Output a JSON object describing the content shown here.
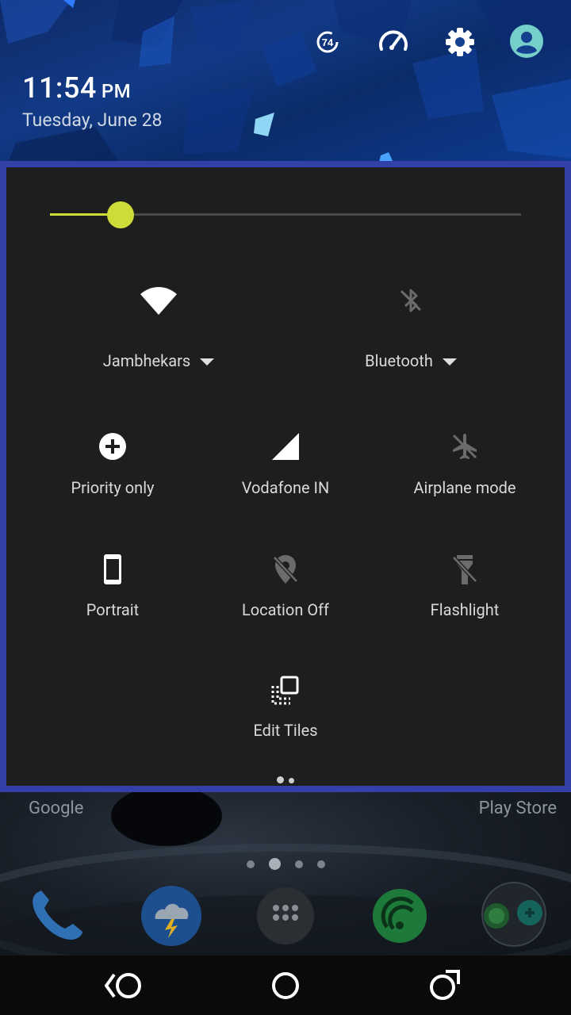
{
  "status": {
    "time": "11:54",
    "ampm": "PM",
    "date": "Tuesday, June 28",
    "battery_badge": "74",
    "header_icons": [
      "battery-saver-icon",
      "speed-icon",
      "gear-icon",
      "account-icon"
    ]
  },
  "brightness": {
    "level": 0.15
  },
  "tiles": {
    "wifi": {
      "label": "Jambhekars",
      "icon": "wifi-icon",
      "state": "on"
    },
    "bluetooth": {
      "label": "Bluetooth",
      "icon": "bluetooth-off-icon",
      "state": "off"
    },
    "priority": {
      "label": "Priority only",
      "icon": "priority-plus-icon"
    },
    "cellular": {
      "label": "Vodafone IN",
      "icon": "signal-icon"
    },
    "airplane": {
      "label": "Airplane mode",
      "icon": "airplane-off-icon"
    },
    "rotation": {
      "label": "Portrait",
      "icon": "phone-portrait-icon"
    },
    "location": {
      "label": "Location Off",
      "icon": "location-off-icon"
    },
    "flashlight": {
      "label": "Flashlight",
      "icon": "flashlight-off-icon"
    },
    "edit": {
      "label": "Edit Tiles",
      "icon": "edit-tiles-icon"
    }
  },
  "qs_pages": {
    "count": 2,
    "active": 0
  },
  "launcher": {
    "left_label": "Google",
    "right_label": "Play Store",
    "pages": {
      "count": 4,
      "active": 1
    },
    "dock": [
      "phone-icon",
      "weather-icon",
      "app-drawer-icon",
      "music-icon",
      "messaging-folder-icon"
    ]
  },
  "navbar": [
    "back-icon",
    "home-icon",
    "recents-icon"
  ],
  "colors": {
    "panel_bg": "#1e1e1e",
    "panel_border": "#3340a8",
    "accent": "#cddc39",
    "wallpaper": "#123a86"
  }
}
